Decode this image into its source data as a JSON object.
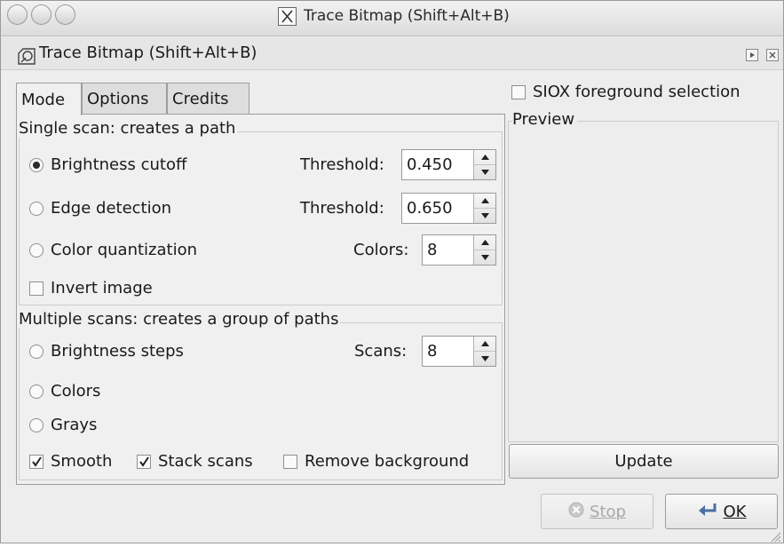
{
  "window": {
    "title": "Trace Bitmap (Shift+Alt+B)",
    "dock_title": "Trace Bitmap (Shift+Alt+B)"
  },
  "tabs": [
    {
      "label": "Mode",
      "active": true
    },
    {
      "label": "Options",
      "active": false
    },
    {
      "label": "Credits",
      "active": false
    }
  ],
  "single_scan": {
    "label": "Single scan: creates a path",
    "brightness_cutoff": {
      "label": "Brightness cutoff",
      "selected": true,
      "param_label": "Threshold:",
      "value": "0.450"
    },
    "edge_detection": {
      "label": "Edge detection",
      "selected": false,
      "param_label": "Threshold:",
      "value": "0.650"
    },
    "color_quantization": {
      "label": "Color quantization",
      "selected": false,
      "param_label": "Colors:",
      "value": "8"
    },
    "invert_image": {
      "label": "Invert image",
      "checked": false
    }
  },
  "multiple_scans": {
    "label": "Multiple scans: creates a group of paths",
    "brightness_steps": {
      "label": "Brightness steps",
      "selected": false,
      "param_label": "Scans:",
      "value": "8"
    },
    "colors": {
      "label": "Colors",
      "selected": false
    },
    "grays": {
      "label": "Grays",
      "selected": false
    },
    "smooth": {
      "label": "Smooth",
      "checked": true
    },
    "stack_scans": {
      "label": "Stack scans",
      "checked": true
    },
    "remove_background": {
      "label": "Remove background",
      "checked": false
    }
  },
  "right_pane": {
    "siox_label": "SIOX foreground selection",
    "siox_checked": false,
    "preview_label": "Preview",
    "update_label": "Update"
  },
  "actions": {
    "stop_label": "Stop",
    "ok_label": "OK"
  }
}
